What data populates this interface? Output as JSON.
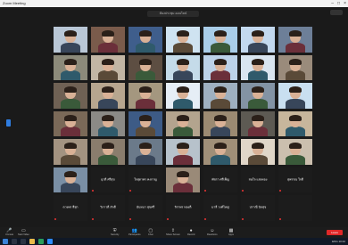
{
  "window": {
    "title": "Zoom Meeting"
  },
  "header": {
    "meeting_label": "ห้องประชุม ออนไลน์"
  },
  "grid": {
    "video_tiles": [
      {
        "name": "",
        "bg": "#b9c7d6"
      },
      {
        "name": "",
        "bg": "#7a5b4b"
      },
      {
        "name": "",
        "bg": "#3f5e8c"
      },
      {
        "name": "",
        "bg": "#cfe3f1"
      },
      {
        "name": "",
        "bg": "#a9cde8"
      },
      {
        "name": "",
        "bg": "#c3d9ef"
      },
      {
        "name": "",
        "bg": "#6d7f98"
      },
      {
        "name": "",
        "bg": "#8c8a7a"
      },
      {
        "name": "",
        "bg": "#c2b6a4"
      },
      {
        "name": "",
        "bg": "#5d4e42"
      },
      {
        "name": "",
        "bg": "#c5dbe9"
      },
      {
        "name": "",
        "bg": "#bcd2e8"
      },
      {
        "name": "",
        "bg": "#d9e5f0"
      },
      {
        "name": "",
        "bg": "#9a8b7b"
      },
      {
        "name": "",
        "bg": "#6f6154"
      },
      {
        "name": "",
        "bg": "#b7a68f"
      },
      {
        "name": "",
        "bg": "#a4977f"
      },
      {
        "name": "",
        "bg": "#e6eef6"
      },
      {
        "name": "",
        "bg": "#9fb0c0"
      },
      {
        "name": "",
        "bg": "#8393a4"
      },
      {
        "name": "",
        "bg": "#c9dff0"
      },
      {
        "name": "",
        "bg": "#7a6958"
      },
      {
        "name": "",
        "bg": "#8b8a86"
      },
      {
        "name": "",
        "bg": "#3d5b86"
      },
      {
        "name": "",
        "bg": "#b3a48e"
      },
      {
        "name": "",
        "bg": "#9b8a72"
      },
      {
        "name": "",
        "bg": "#5d5a53"
      },
      {
        "name": "",
        "bg": "#c7b69c"
      },
      {
        "name": "",
        "bg": "#a39381"
      },
      {
        "name": "",
        "bg": "#8a7d6d"
      },
      {
        "name": "",
        "bg": "#6b7a8a"
      },
      {
        "name": "",
        "bg": "#b7c2cb"
      },
      {
        "name": "",
        "bg": "#a08f78"
      },
      {
        "name": "",
        "bg": "#e0d6c8"
      },
      {
        "name": "",
        "bg": "#cbbfae"
      },
      {
        "name": "",
        "bg": "#7a8fa5"
      },
      {
        "name": "",
        "bg": "#9a8a78"
      },
      {
        "name": "",
        "bg": "#6e6356"
      }
    ],
    "black_tiles": [
      "ยุวดี ศรีสุข",
      "ใจสุดาพร คงกาญ",
      "พัชรา ศรีเพ็ญ",
      "สมใจ แสงทอง",
      "สุพรรณ ใจดี",
      "ดวงพร สีสุก",
      "วิภาวดี ภักดี",
      "นันทนา สุขศรี",
      "จิราพร ทองดี",
      "มาลี วงศ์ใหญ่",
      "ปราณี นิลสุข"
    ]
  },
  "toolbar": {
    "buttons": [
      {
        "icon": "mic-icon",
        "glyph": "🎤",
        "label": "Unmute"
      },
      {
        "icon": "video-icon",
        "glyph": "▭",
        "label": "Start Video"
      },
      {
        "icon": "security-icon",
        "glyph": "⛨",
        "label": "Security"
      },
      {
        "icon": "participants-icon",
        "glyph": "👥",
        "label": "Participants"
      },
      {
        "icon": "chat-icon",
        "glyph": "▢",
        "label": "Chat"
      },
      {
        "icon": "share-icon",
        "glyph": "⇪",
        "label": "Share Screen"
      },
      {
        "icon": "record-icon",
        "glyph": "●",
        "label": "Record"
      },
      {
        "icon": "reactions-icon",
        "glyph": "☺",
        "label": "Reactions"
      },
      {
        "icon": "apps-icon",
        "glyph": "▦",
        "label": "Apps"
      }
    ],
    "leave_label": "Leave"
  },
  "taskbar": {
    "tray_text": "ENG 10:42"
  }
}
